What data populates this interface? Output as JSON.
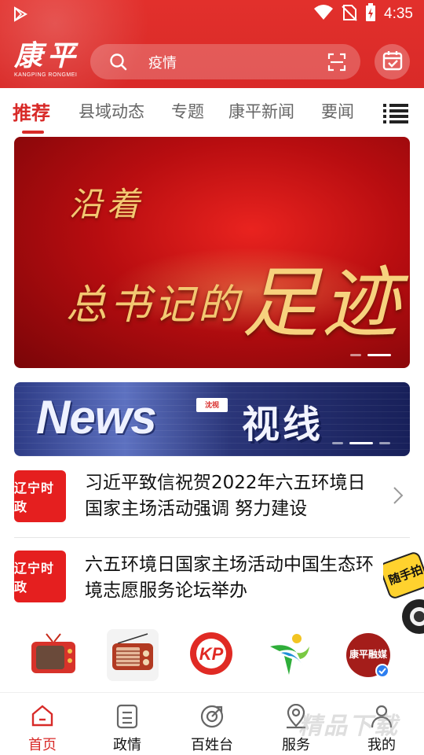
{
  "status_bar": {
    "time": "4:35"
  },
  "app": {
    "logo_text": "康平",
    "logo_sub": "KANGPING RONGMEI"
  },
  "search": {
    "placeholder": "疫情"
  },
  "tabs": [
    {
      "label": "推荐",
      "active": true
    },
    {
      "label": "县域动态"
    },
    {
      "label": "专题"
    },
    {
      "label": "康平新闻"
    },
    {
      "label": "要闻"
    }
  ],
  "banner1": {
    "line1": "沿着",
    "line2": "总书记的",
    "line2_big": "足迹"
  },
  "banner2": {
    "left_text": "News",
    "chip_text": "沈视",
    "right_text": "视线"
  },
  "news": [
    {
      "source": "辽宁时政",
      "title": "习近平致信祝贺2022年六五环境日国家主场活动强调 努力建设"
    },
    {
      "source": "辽宁时政",
      "title": "六五环境日国家主场活动中国生态环境志愿服务论坛举办"
    }
  ],
  "float_badge": {
    "text": "随手拍"
  },
  "shortcuts": [
    {
      "icon": "tv-icon"
    },
    {
      "icon": "radio-icon"
    },
    {
      "icon": "kp-logo-icon"
    },
    {
      "icon": "green-logo-icon"
    },
    {
      "icon": "rongmei-logo-icon",
      "text": "康平融媒"
    }
  ],
  "bottom_nav": [
    {
      "label": "首页",
      "icon": "home-icon",
      "active": true
    },
    {
      "label": "政情",
      "icon": "document-icon"
    },
    {
      "label": "百姓台",
      "icon": "radar-icon"
    },
    {
      "label": "服务",
      "icon": "location-icon"
    },
    {
      "label": "我的",
      "icon": "person-icon"
    }
  ],
  "watermark": "精品下载",
  "colors": {
    "brand_red": "#d82a28",
    "tab_inactive": "#666666"
  }
}
